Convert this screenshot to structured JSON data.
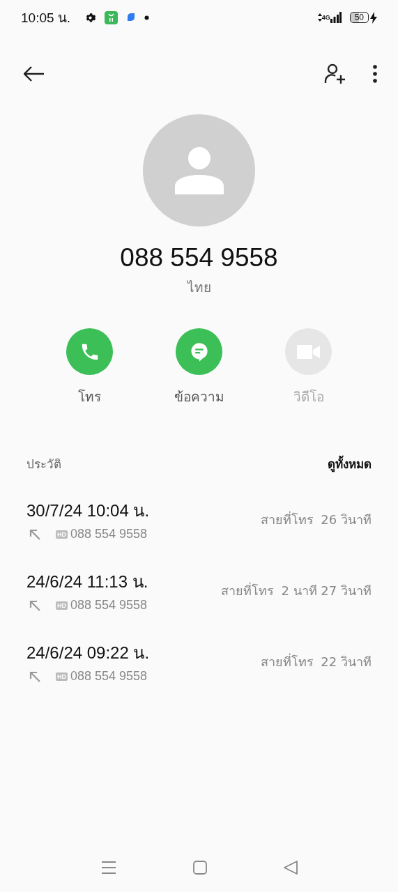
{
  "status_bar": {
    "time": "10:05 น.",
    "network": "4G",
    "battery": "50"
  },
  "contact": {
    "number": "088 554 9558",
    "region": "ไทย"
  },
  "actions": [
    {
      "kind": "call",
      "label": "โทร",
      "disabled": false
    },
    {
      "kind": "message",
      "label": "ข้อความ",
      "disabled": false
    },
    {
      "kind": "video",
      "label": "วิดีโอ",
      "disabled": true
    }
  ],
  "history": {
    "title": "ประวัติ",
    "view_all": "ดูทั้งหมด",
    "calls": [
      {
        "datetime": "30/7/24 10:04 น.",
        "badge": "HD",
        "number": "088 554 9558",
        "type": "สายที่โทร",
        "duration": "26 วินาที"
      },
      {
        "datetime": "24/6/24 11:13 น.",
        "badge": "HD",
        "number": "088 554 9558",
        "type": "สายที่โทร",
        "duration": "2 นาที 27 วินาที"
      },
      {
        "datetime": "24/6/24 09:22 น.",
        "badge": "HD",
        "number": "088 554 9558",
        "type": "สายที่โทร",
        "duration": "22 วินาที"
      }
    ]
  }
}
